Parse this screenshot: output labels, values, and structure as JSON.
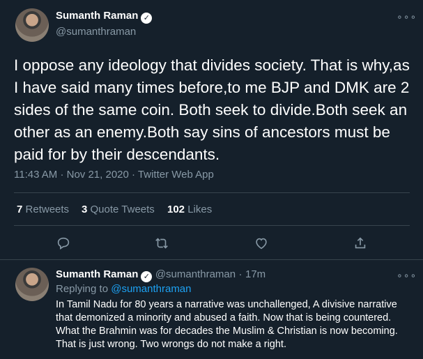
{
  "main_tweet": {
    "author_name": "Sumanth Raman",
    "verified_mark": "✓",
    "handle": "@sumanthraman",
    "more_icon": "more-dots-icon",
    "body": "I oppose any ideology that divides society. That is why,as I have said many times before,to me BJP and DMK are 2 sides of the same coin. Both seek to divide.Both seek an other as an enemy.Both say sins of ancestors must be paid for by their descendants.",
    "time": "11:43 AM",
    "date": "Nov 21, 2020",
    "source": "Twitter Web App",
    "separator": "·"
  },
  "stats": {
    "retweets_count": "7",
    "retweets_label": "Retweets",
    "quotes_count": "3",
    "quotes_label": "Quote Tweets",
    "likes_count": "102",
    "likes_label": "Likes"
  },
  "actions": [
    "reply-icon",
    "retweet-icon",
    "like-icon",
    "share-icon"
  ],
  "reply_tweet": {
    "author_name": "Sumanth Raman",
    "verified_mark": "✓",
    "handle": "@sumanthraman",
    "separator": "·",
    "age": "17m",
    "replying_to_label": "Replying to",
    "replying_to_handle": "@sumanthraman",
    "body": "In Tamil Nadu for 80 years a narrative was unchallenged, A divisive narrative that demonized a minority and abused a faith. Now that is being countered. What the Brahmin was for decades the Muslim & Christian is now becoming. That is just wrong. Two wrongs do not make a right."
  },
  "colors": {
    "background": "#15202b",
    "text": "#ffffff",
    "secondary_text": "#8899a6",
    "link": "#1da1f2",
    "divider": "#38444d"
  }
}
